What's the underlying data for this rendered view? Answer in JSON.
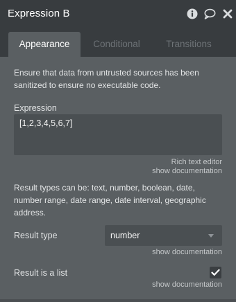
{
  "window": {
    "title": "Expression B",
    "icons": [
      "info-icon",
      "comment-icon",
      "close-icon"
    ]
  },
  "tabs": [
    {
      "label": "Appearance",
      "active": true
    },
    {
      "label": "Conditional",
      "active": false
    },
    {
      "label": "Transitions",
      "active": false
    }
  ],
  "content": {
    "warning_line1": "Ensure that data from untrusted sources has been",
    "warning_line2": "sanitized to ensure no executable code.",
    "expression_label": "Expression",
    "expression_value": "[1,2,3,4,5,6,7]",
    "rich_text_link": "Rich text editor",
    "show_documentation_1": "show documentation",
    "result_types_line1": "Result types can be: text, number, boolean, date,",
    "result_types_line2": "number range, date range, date interval, geographic",
    "result_types_line3": "address.",
    "result_type_label": "Result type",
    "result_type_value": "number",
    "show_documentation_2": "show documentation",
    "result_is_list_label": "Result is a list",
    "result_is_list_checked": true,
    "show_documentation_3": "show documentation"
  },
  "colors": {
    "titlebar": "#383c3f",
    "panel": "#5a5f62",
    "input": "#4a4f52",
    "inactive_tab_text": "#6d7276"
  }
}
